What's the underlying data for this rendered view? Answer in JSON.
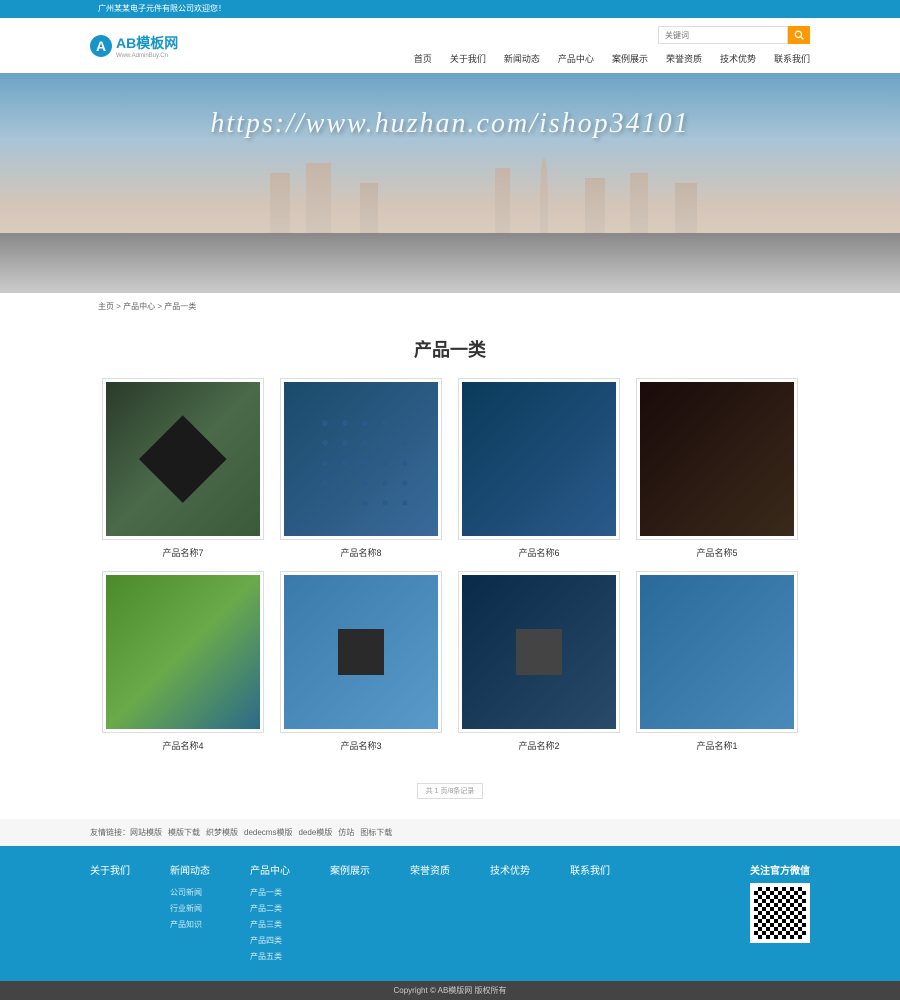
{
  "topbar": {
    "welcome": "广州某某电子元件有限公司欢迎您！"
  },
  "logo": {
    "main": "AB模板网",
    "sub": "Www.AdminBuy.Cn"
  },
  "search": {
    "placeholder": "关键词"
  },
  "nav": {
    "items": [
      {
        "label": "首页"
      },
      {
        "label": "关于我们"
      },
      {
        "label": "新闻动态"
      },
      {
        "label": "产品中心"
      },
      {
        "label": "案例展示"
      },
      {
        "label": "荣誉资质"
      },
      {
        "label": "技术优势"
      },
      {
        "label": "联系我们"
      }
    ]
  },
  "banner": {
    "watermark": "https://www.huzhan.com/ishop34101"
  },
  "breadcrumb": {
    "home": "主页",
    "l1": "产品中心",
    "l2": "产品一类"
  },
  "page": {
    "title": "产品一类"
  },
  "products": [
    {
      "name": "产品名称7",
      "cls": "chip1"
    },
    {
      "name": "产品名称8",
      "cls": "chip2"
    },
    {
      "name": "产品名称6",
      "cls": "chip3"
    },
    {
      "name": "产品名称5",
      "cls": "chip4"
    },
    {
      "name": "产品名称4",
      "cls": "chip5"
    },
    {
      "name": "产品名称3",
      "cls": "chip6"
    },
    {
      "name": "产品名称2",
      "cls": "chip7"
    },
    {
      "name": "产品名称1",
      "cls": "chip8"
    }
  ],
  "pagination": {
    "info": "共 1 页/8条记录"
  },
  "friendlinks": {
    "label": "友情链接：",
    "items": [
      "网站模版",
      "模版下载",
      "织梦模版",
      "dedecms模版",
      "dede模版",
      "仿站",
      "图标下载"
    ]
  },
  "footer": {
    "cols": [
      {
        "title": "关于我们",
        "links": []
      },
      {
        "title": "新闻动态",
        "links": [
          "公司新闻",
          "行业新闻",
          "产品知识"
        ]
      },
      {
        "title": "产品中心",
        "links": [
          "产品一类",
          "产品二类",
          "产品三类",
          "产品四类",
          "产品五类"
        ]
      },
      {
        "title": "案例展示",
        "links": []
      },
      {
        "title": "荣誉资质",
        "links": []
      },
      {
        "title": "技术优势",
        "links": []
      },
      {
        "title": "联系我们",
        "links": []
      }
    ],
    "qr_title": "关注官方微信"
  },
  "copyright": {
    "text": "Copyright © AB模版网 版权所有"
  }
}
